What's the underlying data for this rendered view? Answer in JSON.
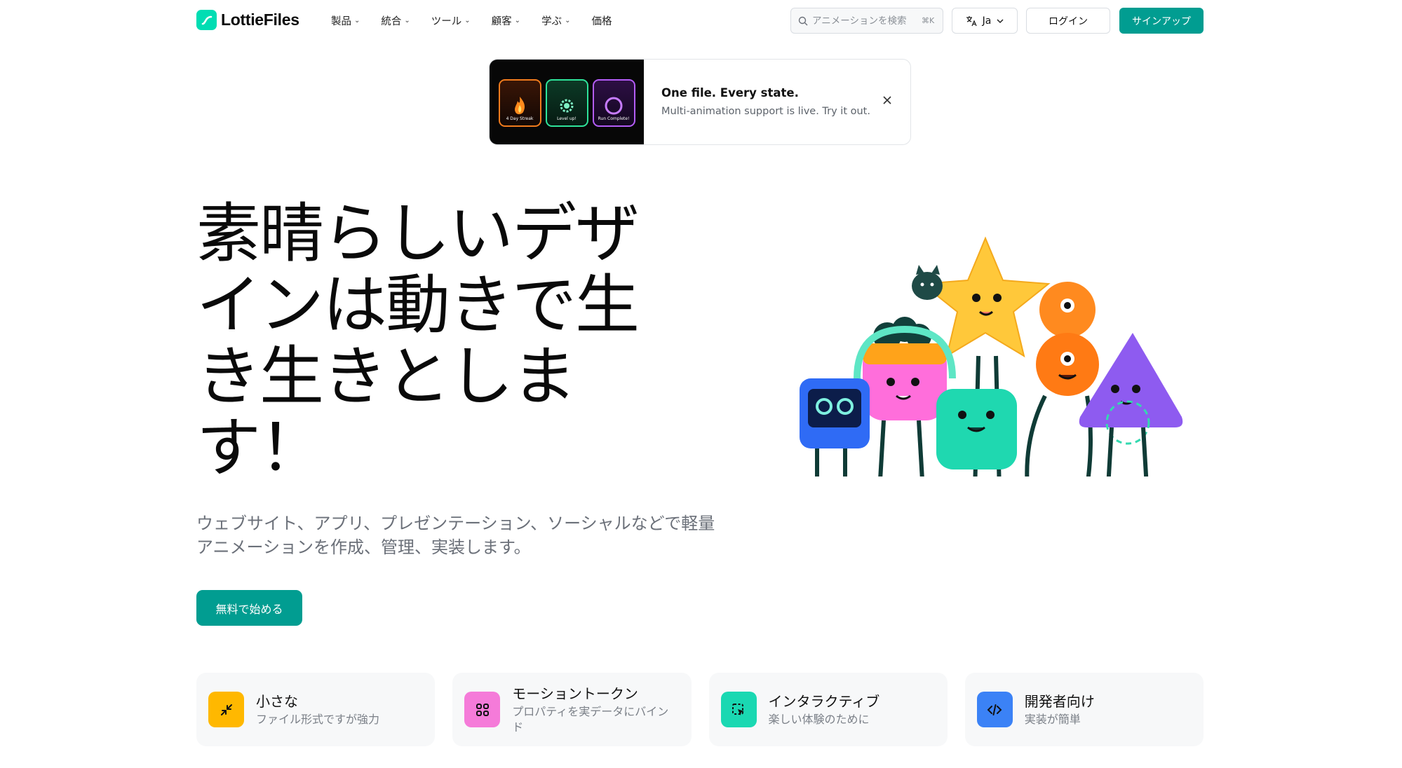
{
  "header": {
    "logo_text": "LottieFiles",
    "nav": [
      {
        "label": "製品"
      },
      {
        "label": "統合"
      },
      {
        "label": "ツール"
      },
      {
        "label": "顧客"
      },
      {
        "label": "学ぶ"
      },
      {
        "label": "価格"
      }
    ],
    "search_placeholder": "アニメーションを検索",
    "search_shortcut": "⌘K",
    "language": "Ja",
    "login": "ログイン",
    "signup": "サインアップ"
  },
  "banner": {
    "title": "One file. Every state.",
    "subtitle": "Multi-animation support is live. Try it out.",
    "tiles": [
      "4 Day Streak",
      "Level up!",
      "Run Complete!"
    ]
  },
  "hero": {
    "title": "素晴らしいデザインは動きで生き生きとします！",
    "subtitle": "ウェブサイト、アプリ、プレゼンテーション、ソーシャルなどで軽量アニメーションを作成、管理、実装します。",
    "cta": "無料で始める"
  },
  "features": [
    {
      "title": "小さな",
      "subtitle": "ファイル形式ですが強力",
      "icon": "compress-icon",
      "color": "#FFB800"
    },
    {
      "title": "モーショントークン",
      "subtitle": "プロパティを実データにバインド",
      "icon": "grid-icon",
      "color": "#F57BD9"
    },
    {
      "title": "インタラクティブ",
      "subtitle": "楽しい体験のために",
      "icon": "pointer-select-icon",
      "color": "#1AD8B2"
    },
    {
      "title": "開発者向け",
      "subtitle": "実装が簡単",
      "icon": "code-icon",
      "color": "#3B82F6"
    }
  ],
  "colors": {
    "brand": "#019D91",
    "logo": "#00DDB3"
  }
}
